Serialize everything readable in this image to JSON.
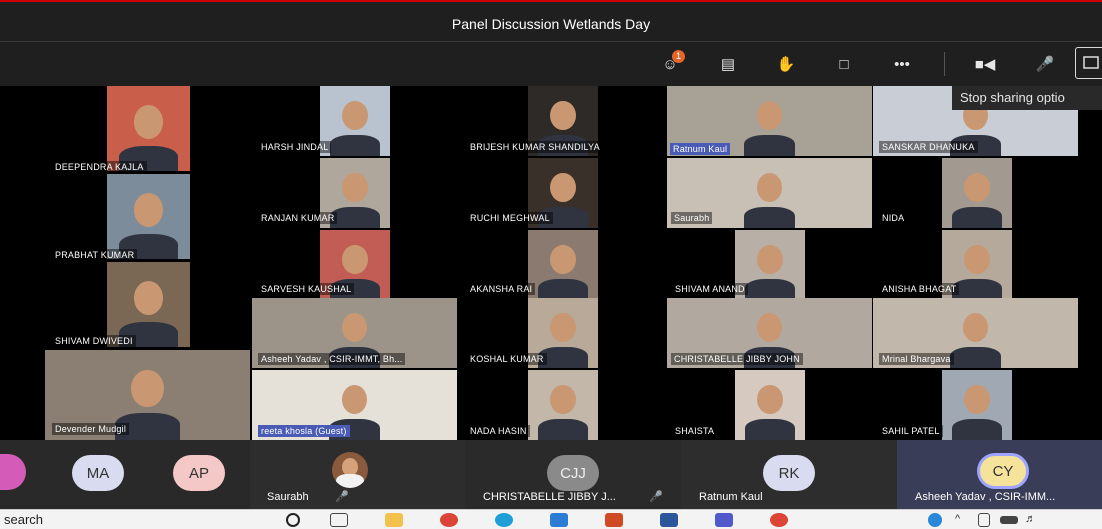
{
  "meeting": {
    "title": "Panel Discussion Wetlands Day"
  },
  "toolbar": {
    "participants_badge": "1",
    "tooltip": "Stop sharing optio"
  },
  "tiles": [
    "DEEPENDRA KAJLA",
    "HARSH JINDAL",
    "BRIJESH KUMAR SHANDILYA",
    "Ratnum Kaul",
    "SANSKAR DHANUKA",
    "RANJAN KUMAR",
    "RUCHI MEGHWAL",
    "Saurabh",
    "NIDA",
    "PRABHAT KUMAR",
    "SARVESH KAUSHAL",
    "AKANSHA RAI",
    "SHIVAM ANAND",
    "ANISHA BHAGAT",
    "SHIVAM DWIVEDI",
    "Asheeh Yadav , CSIR-IMMT, Bh...",
    "KOSHAL KUMAR",
    "CHRISTABELLE JIBBY JOHN",
    "Mrinal Bhargava",
    "Devender Mudgil",
    "reeta khosla (Guest)",
    "NADA HASIN",
    "SHAISTA",
    "SAHIL PATEL"
  ],
  "strip": {
    "avatars": [
      "MA",
      "AP"
    ],
    "cells": [
      {
        "name": "Saurabh",
        "initials": ""
      },
      {
        "name": "CHRISTABELLE JIBBY J...",
        "initials": "CJJ"
      },
      {
        "name": "Ratnum Kaul",
        "initials": "RK"
      },
      {
        "name": "Asheeh Yadav , CSIR-IMM...",
        "initials": "CY"
      }
    ]
  },
  "taskbar": {
    "search": "search"
  },
  "colors": {
    "accent": "#c50f1f",
    "toolbar": "#1f1f1f",
    "strip": "#292929",
    "name_highlight": "#4a5bb5"
  }
}
